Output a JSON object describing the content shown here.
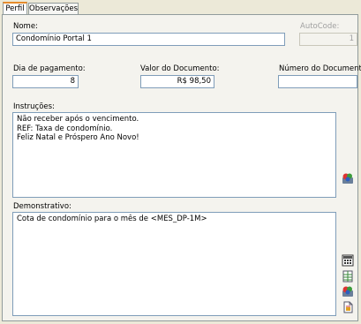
{
  "tabs": [
    {
      "label": "Perfil",
      "active": true
    },
    {
      "label": "Observações",
      "active": false
    }
  ],
  "form": {
    "nome_label": "Nome:",
    "nome_value": "Condomínio Portal 1",
    "autocode_label": "AutoCode:",
    "autocode_value": "1",
    "dia_label": "Dia de pagamento:",
    "dia_value": "8",
    "valor_label": "Valor do Documento:",
    "valor_value": "R$ 98,50",
    "numero_label": "Número do Documento:",
    "numero_value": "",
    "instrucoes_label": "Instruções:",
    "instrucoes_lines": [
      "Não receber após o vencimento.",
      "REF: Taxa de condomínio.",
      "Feliz Natal e Próspero Ano Novo!"
    ],
    "demonstrativo_label": "Demonstrativo:",
    "demonstrativo_lines": [
      "Cota de condomínio para o mês de <MES_DP-1M>"
    ]
  },
  "icons": {
    "instrucoes_tool": "macro-variables-icon",
    "demo_tools": [
      "calculator-icon",
      "spreadsheet-icon",
      "macro-variables-icon",
      "report-icon"
    ]
  },
  "colors": {
    "active_tab_accent": "#e68b2c",
    "field_border": "#7f9db9",
    "panel_bg": "#f4f3ee"
  }
}
